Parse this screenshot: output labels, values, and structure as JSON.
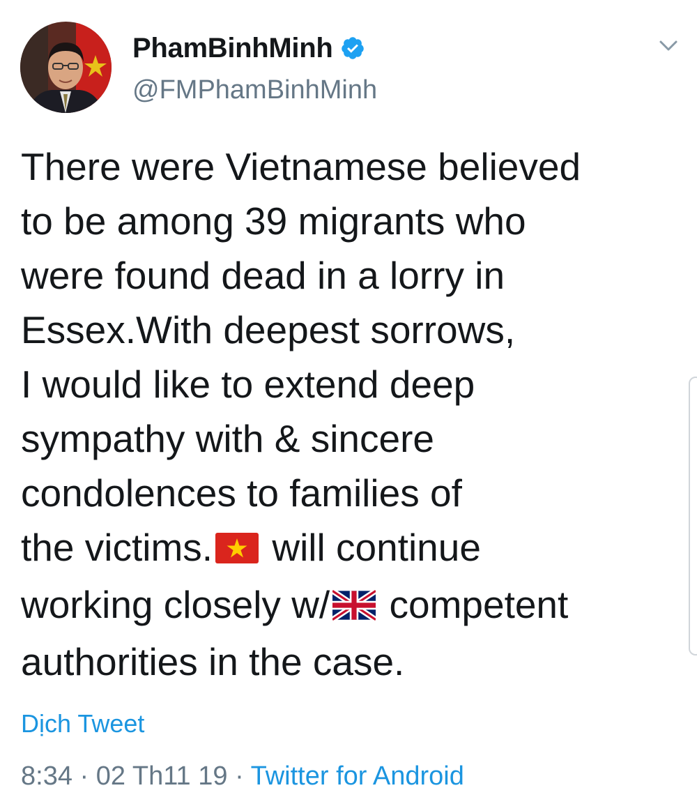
{
  "author": {
    "display_name": "PhamBinhMinh",
    "handle": "@FMPhamBinhMinh",
    "verified_icon": "verified-badge-icon",
    "avatar": "profile-photo"
  },
  "menu": {
    "icon": "chevron-down-icon"
  },
  "tweet": {
    "lines": [
      "There were Vietnamese believed",
      "to be among 39 migrants who",
      "were found dead in a lorry in",
      "Essex.With deepest sorrows,",
      "I would like to extend deep",
      "sympathy with & sincere",
      "condolences to families of"
    ],
    "line8_before": "the victims.",
    "line8_after": " will continue",
    "line9_before": "working closely w/",
    "line9_after": " competent",
    "line10": "authorities in the case.",
    "emoji_1": "vietnam-flag-icon",
    "emoji_2": "uk-flag-icon"
  },
  "translate_label": "Dịch Tweet",
  "meta": {
    "time": "8:34",
    "separator1": " · ",
    "date": "02 Th11 19",
    "separator2": " · ",
    "source": "Twitter for Android"
  },
  "colors": {
    "link": "#1b95e0",
    "secondary_text": "#657786",
    "primary_text": "#14171a",
    "verified": "#1da1f2"
  }
}
